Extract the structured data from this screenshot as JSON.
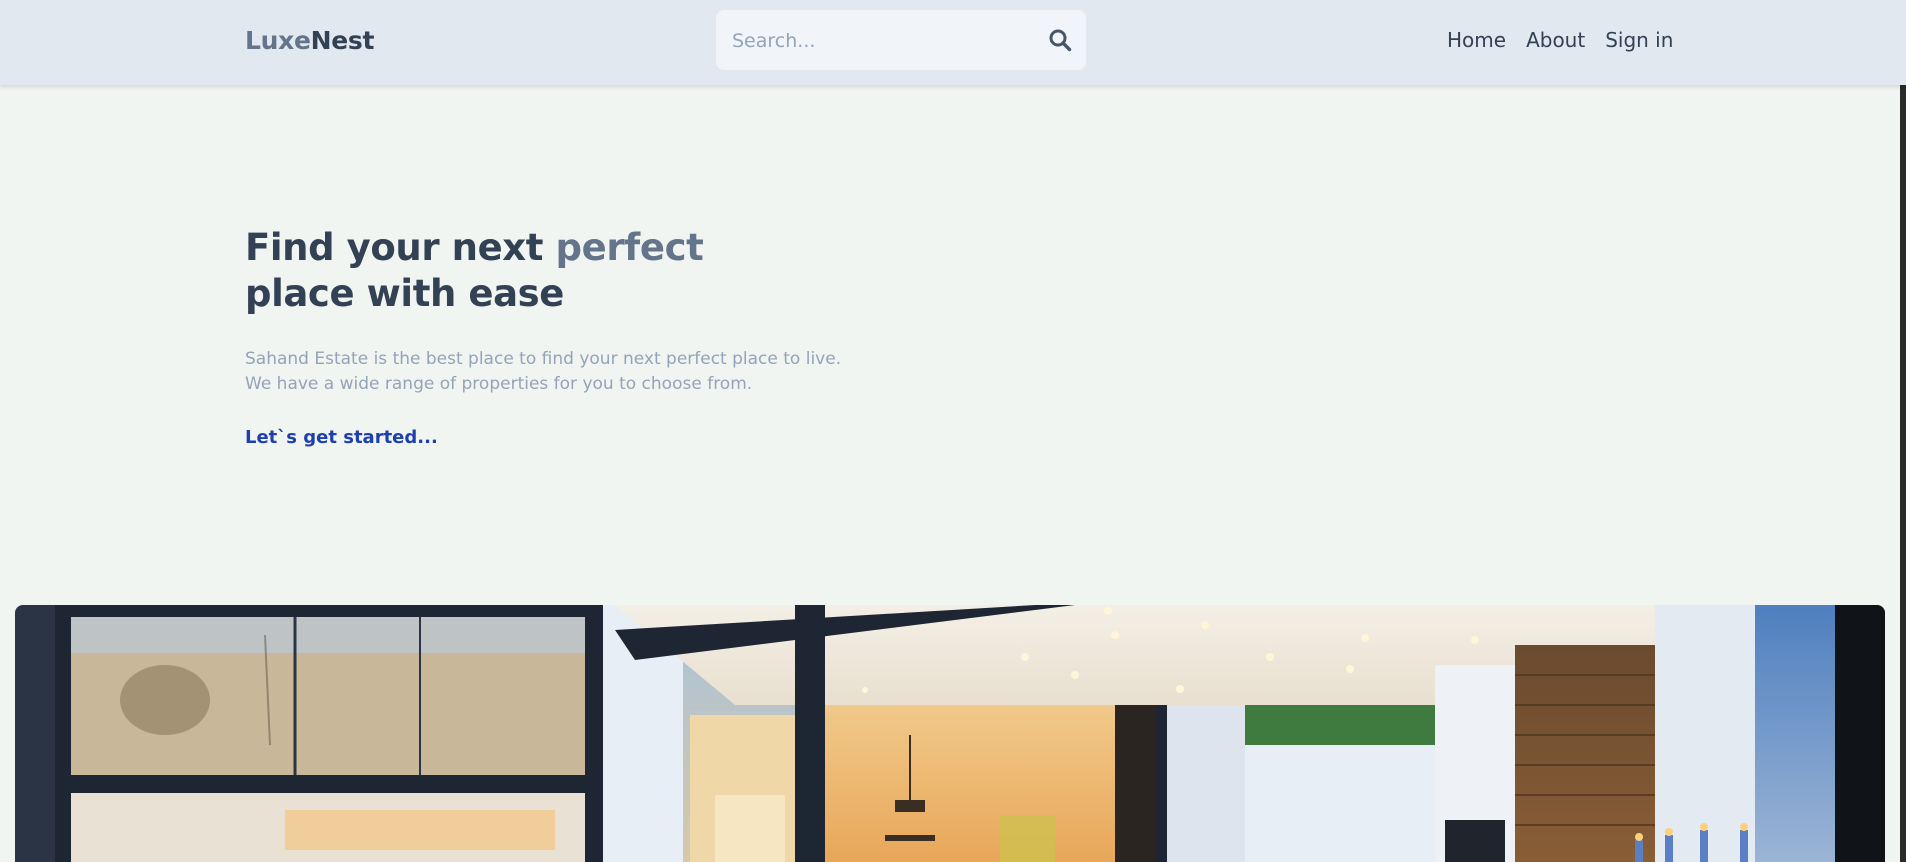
{
  "header": {
    "logo_part1": "Luxe",
    "logo_part2": "Nest",
    "search_placeholder": "Search...",
    "search_icon": "search-icon",
    "nav": [
      "Home",
      "About",
      "Sign in"
    ]
  },
  "hero": {
    "title_part1": "Find your next ",
    "title_accent": "perfect",
    "title_line2": "place with ease",
    "desc_line1": "Sahand Estate is the best place to find your next perfect place to live.",
    "desc_line2": "We have a wide range of properties for you to choose from.",
    "cta": "Let`s get started..."
  },
  "colors": {
    "background": "#f1f5f1",
    "header_bg": "#e2e8f0",
    "text_dark": "#334155",
    "text_muted": "#64748b",
    "text_light": "#94a3b8",
    "link": "#1e40af"
  }
}
